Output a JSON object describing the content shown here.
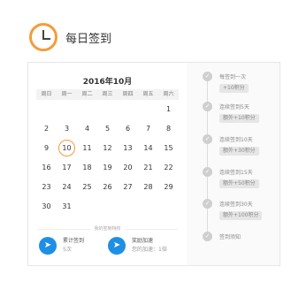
{
  "header": {
    "title": "每日签到",
    "icon": "clock-icon"
  },
  "calendar": {
    "month_title": "2016年10月",
    "weekdays": [
      "周日",
      "周一",
      "周二",
      "周三",
      "周四",
      "周五",
      "周六"
    ],
    "weeks": [
      [
        "",
        "",
        "",
        "",
        "",
        "",
        "1"
      ],
      [
        "2",
        "3",
        "4",
        "5",
        "6",
        "7",
        "8"
      ],
      [
        "9",
        "10",
        "11",
        "12",
        "13",
        "14",
        "15"
      ],
      [
        "16",
        "17",
        "18",
        "19",
        "20",
        "21",
        "22"
      ],
      [
        "23",
        "24",
        "25",
        "26",
        "27",
        "28",
        "29"
      ],
      [
        "30",
        "31",
        "",
        "",
        "",
        "",
        ""
      ]
    ],
    "today": "10",
    "privilege_label": "我的签到特权",
    "features": [
      {
        "icon": "rocket-icon",
        "label": "累计签到",
        "value": "5次"
      },
      {
        "icon": "rocket-icon",
        "label": "奖励加速",
        "value": "您的加速：1倍"
      }
    ]
  },
  "steps": [
    {
      "label": "每签到一次",
      "reward": "+10积分"
    },
    {
      "label": "连续签到5天",
      "reward": "额外+10积分"
    },
    {
      "label": "连续签到10天",
      "reward": "额外+30积分"
    },
    {
      "label": "连续签到15天",
      "reward": "额外+50积分"
    },
    {
      "label": "连续签到30天",
      "reward": "额外+100积分"
    },
    {
      "label": "签到须知",
      "reward": ""
    }
  ],
  "colors": {
    "accent": "#f39c3a",
    "feature_blue": "#1e8fe5"
  }
}
